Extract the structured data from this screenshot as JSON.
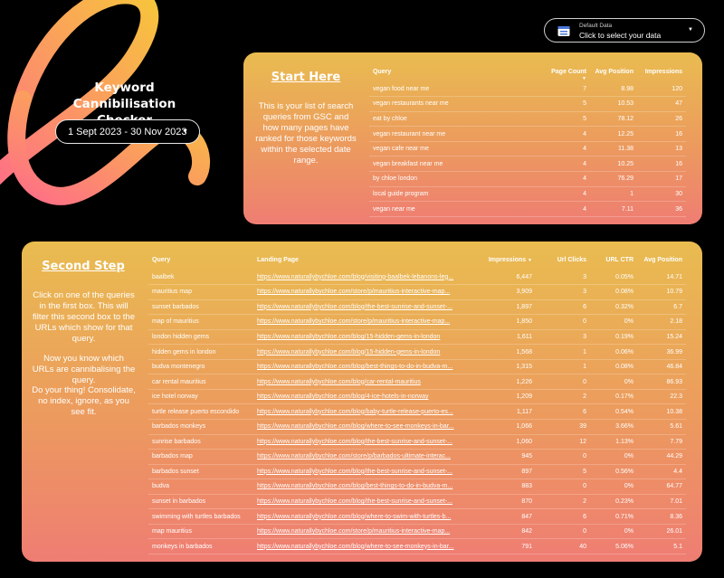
{
  "app": {
    "title": "Keyword Cannibilisation Checker",
    "date_range": "1 Sept 2023 - 30 Nov 2023"
  },
  "data_source": {
    "label": "Default Data",
    "value": "Click to select your data",
    "icon": "database-icon"
  },
  "colors": {
    "panel_top": "#e9bc50",
    "panel_mid": "#ec9a5e",
    "panel_bottom": "#ef7d73",
    "swirl_start": "#ff6f87",
    "swirl_end": "#f7c43c"
  },
  "step1": {
    "title": "Start Here",
    "text": "This is your list of search queries from GSC and how many pages have ranked for those keywords within the selected date range.",
    "table": {
      "headers": [
        "Query",
        "Page Count",
        "Avg Position",
        "Impressions"
      ],
      "rows": [
        [
          "vegan food near me",
          "7",
          "8.98",
          "120"
        ],
        [
          "vegan restaurants near me",
          "5",
          "10.53",
          "47"
        ],
        [
          "eat by chloe",
          "5",
          "78.12",
          "26"
        ],
        [
          "vegan restaurant near me",
          "4",
          "12.25",
          "16"
        ],
        [
          "vegan cafe near me",
          "4",
          "11.38",
          "13"
        ],
        [
          "vegan breakfast near me",
          "4",
          "10.25",
          "16"
        ],
        [
          "by chloe london",
          "4",
          "76.29",
          "17"
        ],
        [
          "local guide program",
          "4",
          "1",
          "30"
        ],
        [
          "vegan near me",
          "4",
          "7.11",
          "36"
        ]
      ]
    }
  },
  "step2": {
    "title": "Second Step",
    "text_1": "Click on one of the queries in the first box. This will filter this second box to the URLs which show for that query.",
    "text_2": "Now you know which URLs are cannibalising the query.",
    "text_3": "Do your thing! Consolidate, no index, ignore, as you see fit.",
    "table": {
      "headers": [
        "Query",
        "Landing Page",
        "Impressions",
        "Url Clicks",
        "URL CTR",
        "Avg Position"
      ],
      "rows": [
        [
          "baalbek",
          "https://www.naturallybychloe.com/blog/visiting-baalbek-lebanons-leg...",
          "6,447",
          "3",
          "0.05%",
          "14.71"
        ],
        [
          "mauritius map",
          "https://www.naturallybychloe.com/store/p/mauritius-interactive-map...",
          "3,909",
          "3",
          "0.08%",
          "10.79"
        ],
        [
          "sunset barbados",
          "https://www.naturallybychloe.com/blog/the-best-sunrise-and-sunset-...",
          "1,897",
          "6",
          "0.32%",
          "6.7"
        ],
        [
          "map of mauritius",
          "https://www.naturallybychloe.com/store/p/mauritius-interactive-map...",
          "1,850",
          "0",
          "0%",
          "2.18"
        ],
        [
          "london hidden gems",
          "https://www.naturallybychloe.com/blog/15-hidden-gems-in-london",
          "1,611",
          "3",
          "0.19%",
          "15.24"
        ],
        [
          "hidden gems in london",
          "https://www.naturallybychloe.com/blog/15-hidden-gems-in-london",
          "1,568",
          "1",
          "0.06%",
          "36.99"
        ],
        [
          "budva montenegro",
          "https://www.naturallybychloe.com/blog/best-things-to-do-in-budva-m...",
          "1,315",
          "1",
          "0.08%",
          "46.84"
        ],
        [
          "car rental mauritius",
          "https://www.naturallybychloe.com/blog/car-rental-mauritius",
          "1,226",
          "0",
          "0%",
          "86.93"
        ],
        [
          "ice hotel norway",
          "https://www.naturallybychloe.com/blog/4-ice-hotels-in-norway",
          "1,209",
          "2",
          "0.17%",
          "22.3"
        ],
        [
          "turtle release puerto escondido",
          "https://www.naturallybychloe.com/blog/baby-turtle-release-puerto-es...",
          "1,117",
          "6",
          "0.54%",
          "10.38"
        ],
        [
          "barbados monkeys",
          "https://www.naturallybychloe.com/blog/where-to-see-monkeys-in-bar...",
          "1,066",
          "39",
          "3.66%",
          "5.61"
        ],
        [
          "sunrise barbados",
          "https://www.naturallybychloe.com/blog/the-best-sunrise-and-sunset-...",
          "1,060",
          "12",
          "1.13%",
          "7.79"
        ],
        [
          "barbados map",
          "https://www.naturallybychloe.com/store/p/barbados-ultimate-interac...",
          "945",
          "0",
          "0%",
          "44.29"
        ],
        [
          "barbados sunset",
          "https://www.naturallybychloe.com/blog/the-best-sunrise-and-sunset-...",
          "897",
          "5",
          "0.56%",
          "4.4"
        ],
        [
          "budva",
          "https://www.naturallybychloe.com/blog/best-things-to-do-in-budva-m...",
          "883",
          "0",
          "0%",
          "64.77"
        ],
        [
          "sunset in barbados",
          "https://www.naturallybychloe.com/blog/the-best-sunrise-and-sunset-...",
          "870",
          "2",
          "0.23%",
          "7.01"
        ],
        [
          "swimming with turtles barbados",
          "https://www.naturallybychloe.com/blog/where-to-swim-with-turtles-b...",
          "847",
          "6",
          "0.71%",
          "8.36"
        ],
        [
          "map mauritius",
          "https://www.naturallybychloe.com/store/p/mauritius-interactive-map...",
          "842",
          "0",
          "0%",
          "26.01"
        ],
        [
          "monkeys in barbados",
          "https://www.naturallybychloe.com/blog/where-to-see-monkeys-in-bar...",
          "791",
          "40",
          "5.06%",
          "5.1"
        ]
      ]
    }
  }
}
